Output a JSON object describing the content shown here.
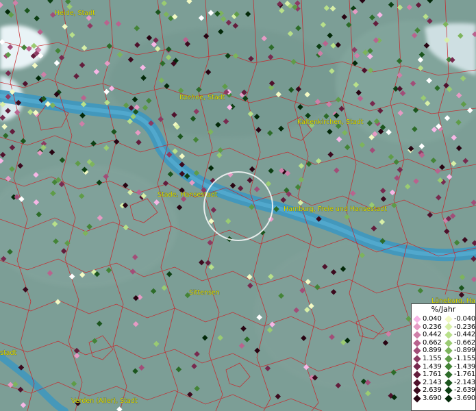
{
  "places": [
    {
      "id": "heide",
      "name": "Heide, Stadt"
    },
    {
      "id": "itzehoe",
      "name": "Itzehoe, Stadt"
    },
    {
      "id": "kaltenkirchen",
      "name": "Kaltenkirchen, Stadt"
    },
    {
      "id": "stade",
      "name": "Stade, Hansestadt"
    },
    {
      "id": "hamburg",
      "name": "Hamburg, Freie und Hansestadt"
    },
    {
      "id": "sittensen",
      "name": "Sittensen"
    },
    {
      "id": "lueneburg",
      "name": "Lüneburg, Ha"
    },
    {
      "id": "left-edge",
      "name": "stadt"
    },
    {
      "id": "verden",
      "name": "Verden (Aller), Stadt"
    }
  ],
  "legend": {
    "title": "%/Jahr",
    "positive": [
      {
        "label": "0.040",
        "color": "#f7b6e6"
      },
      {
        "label": "0.236",
        "color": "#e69ac4"
      },
      {
        "label": "0.442",
        "color": "#cf7fa8"
      },
      {
        "label": "0.662",
        "color": "#b9638e"
      },
      {
        "label": "0.899",
        "color": "#a24d78"
      },
      {
        "label": "1.155",
        "color": "#8d3a62"
      },
      {
        "label": "1.439",
        "color": "#782a4f"
      },
      {
        "label": "1.761",
        "color": "#631d3c"
      },
      {
        "label": "2.143",
        "color": "#4f112c"
      },
      {
        "label": "2.639",
        "color": "#3c0a1e"
      },
      {
        "label": "3.690",
        "color": "#280412"
      }
    ],
    "negative": [
      {
        "label": "-0.040",
        "color": "#f3fac4"
      },
      {
        "label": "-0.236",
        "color": "#d7efa7"
      },
      {
        "label": "-0.442",
        "color": "#b8e08a"
      },
      {
        "label": "-0.662",
        "color": "#9acb72"
      },
      {
        "label": "-0.899",
        "color": "#7db45c"
      },
      {
        "label": "-1.155",
        "color": "#5f9c48"
      },
      {
        "label": "-1.439",
        "color": "#448437"
      },
      {
        "label": "-1.761",
        "color": "#2d6c29"
      },
      {
        "label": "-2.143",
        "color": "#1b551d"
      },
      {
        "label": "-2.639",
        "color": "#0d3f13"
      },
      {
        "label": "-3.690",
        "color": "#032909"
      }
    ]
  },
  "colors": {
    "land": "#7c9e96",
    "boundary": "#c8262b",
    "water": "#3d97c0",
    "cloud": "#e9f3f6"
  }
}
